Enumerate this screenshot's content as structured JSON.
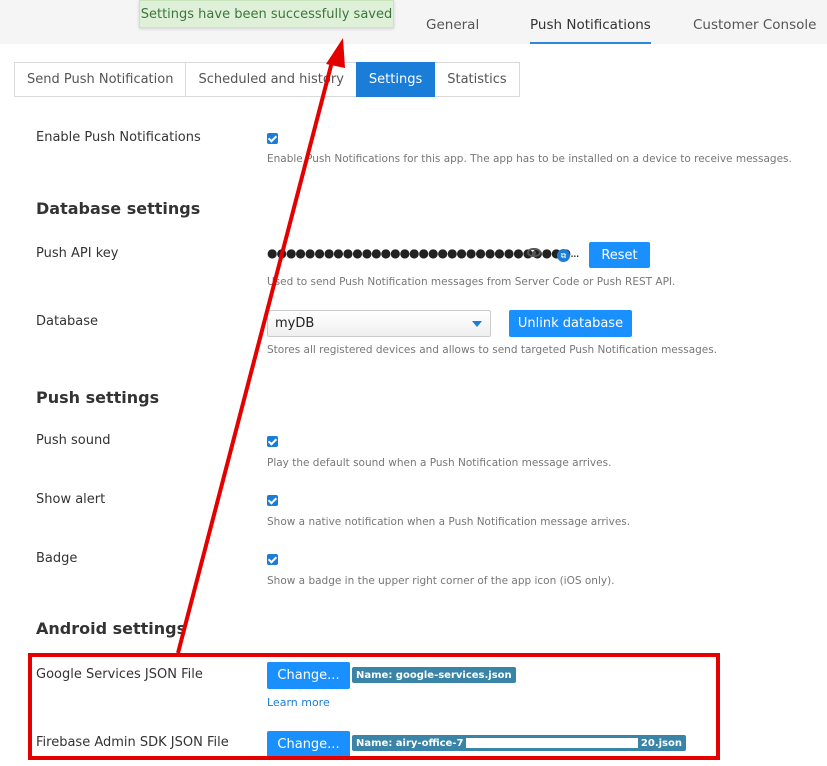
{
  "toast": {
    "message": "Settings have been successfully saved"
  },
  "top_tabs": [
    {
      "label": "General"
    },
    {
      "label": "Push Notifications",
      "active": true
    },
    {
      "label": "Customer Console"
    }
  ],
  "sub_tabs": [
    {
      "label": "Send Push Notification"
    },
    {
      "label": "Scheduled and history"
    },
    {
      "label": "Settings",
      "active": true
    },
    {
      "label": "Statistics"
    }
  ],
  "enable_push": {
    "label": "Enable Push Notifications",
    "checked": true,
    "help": "Enable Push Notifications for this app. The app has to be installed on a device to receive messages."
  },
  "database_settings": {
    "heading": "Database settings",
    "api_key": {
      "label": "Push API key",
      "value": "●●●●●●●●●●●●●●●●●●●●●●●●●●●●●●●●...",
      "reset_label": "Reset",
      "help": "Used to send Push Notification messages from Server Code or Push REST API."
    },
    "database": {
      "label": "Database",
      "selected": "myDB",
      "unlink_label": "Unlink database",
      "help": "Stores all registered devices and allows to send targeted Push Notification messages."
    }
  },
  "push_settings": {
    "heading": "Push settings",
    "sound": {
      "label": "Push sound",
      "checked": true,
      "help": "Play the default sound when a Push Notification message arrives."
    },
    "alert": {
      "label": "Show alert",
      "checked": true,
      "help": "Show a native notification when a Push Notification message arrives."
    },
    "badge": {
      "label": "Badge",
      "checked": true,
      "help": "Show a badge in the upper right corner of the app icon (iOS only)."
    }
  },
  "android_settings": {
    "heading": "Android settings",
    "google_services": {
      "label": "Google Services JSON File",
      "change_label": "Change...",
      "file_name": "Name: google-services.json",
      "learn_more": "Learn more"
    },
    "firebase_admin": {
      "label": "Firebase Admin SDK JSON File",
      "change_label": "Change...",
      "file_name_prefix": "Name: airy-office-7",
      "file_name_suffix": "20.json"
    }
  },
  "colors": {
    "accent": "#1a7dd7",
    "button": "#1a90ff",
    "annotation": "#e50000",
    "toast_bg": "#dff0d8"
  },
  "icons": {
    "eye": "eye-icon",
    "copy": "copy-icon",
    "checkbox": "checkbox-checked-icon"
  }
}
